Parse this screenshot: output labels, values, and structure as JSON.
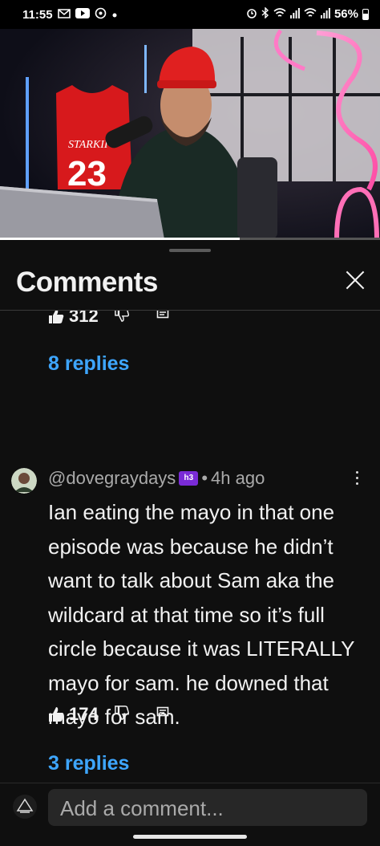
{
  "status_bar": {
    "time": "11:55",
    "battery": "56%",
    "left_icons": [
      "gmail-icon",
      "youtube-icon",
      "whatsapp-icon",
      "dot-icon"
    ],
    "right_icons": [
      "alarm-icon",
      "bluetooth-icon",
      "wifi-calling-icon",
      "signal-icon",
      "wifi-calling-2-icon",
      "signal-2-icon",
      "battery-icon"
    ]
  },
  "video": {
    "jersey_name": "STARKII",
    "jersey_number": "23",
    "progress_fraction": 0.63
  },
  "sheet": {
    "title": "Comments"
  },
  "prev_comment": {
    "likes": "312",
    "replies_label": "8 replies"
  },
  "comment": {
    "author": "@dovegraydays",
    "badge": "h3",
    "separator": "•",
    "time": "4h ago",
    "text": "Ian eating the mayo in that one episode was because he didn’t want to talk about Sam aka the wildcard at that time so it’s full circle because it was LITERALLY mayo for sam. he downed that mayo for sam.",
    "likes": "174",
    "replies_label": "3 replies"
  },
  "input": {
    "placeholder": "Add a comment..."
  },
  "colors": {
    "background": "#0f0f0f",
    "link": "#3ea6ff",
    "input_bg": "#272727"
  }
}
